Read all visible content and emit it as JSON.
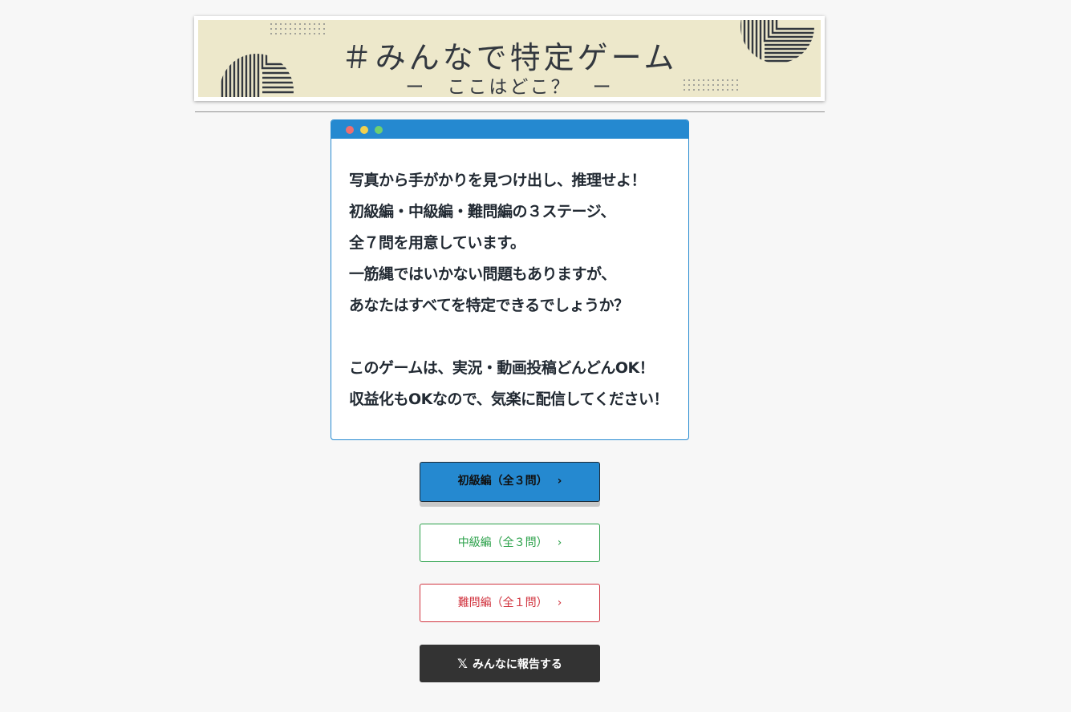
{
  "banner": {
    "title": "＃みんなで特定ゲーム",
    "subtitle": "ー　ここはどこ？　ー"
  },
  "intro": {
    "lines": [
      "写真から手がかりを見つけ出し、推理せよ！",
      "初級編・中級編・難問編の３ステージ、",
      "全７問を用意しています。",
      "一筋縄ではいかない問題もありますが、",
      "あなたはすべてを特定できるでしょうか？",
      "このゲームは、実況・動画投稿どんどんOK！",
      "収益化もOKなので、気楽に配信してください！"
    ]
  },
  "buttons": {
    "beginner": "初級編（全３問）",
    "intermediate": "中級編（全３問）",
    "hard": "難問編（全１問）",
    "report": "みんなに報告する",
    "chevron": "›",
    "x_logo": "𝕏"
  },
  "colors": {
    "accent_blue": "#2589d0",
    "green": "#2ba14a",
    "red": "#d1343f",
    "dark": "#333333",
    "banner_bg": "#ede8cb"
  }
}
